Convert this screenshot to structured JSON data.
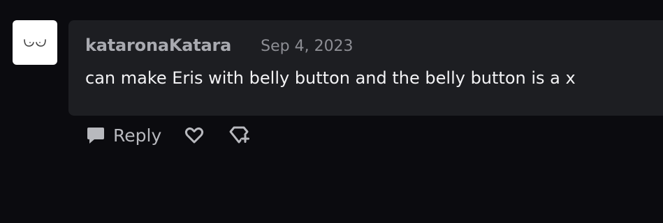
{
  "comment": {
    "username": "kataronaKatara",
    "date": "Sep 4, 2023",
    "text": "can make Eris with belly button and the belly button is a x"
  },
  "actions": {
    "reply_label": "Reply"
  },
  "icons": {
    "avatar": "face-avatar-icon",
    "reply": "speech-bubble-icon",
    "like": "heart-outline-icon",
    "award": "gem-plus-icon"
  },
  "colors": {
    "background": "#0b0b0f",
    "card": "#1d1e22",
    "username": "#a9aab0",
    "date": "#8d8e94",
    "text": "#f3f3f5",
    "actions": "#b8b9be"
  }
}
